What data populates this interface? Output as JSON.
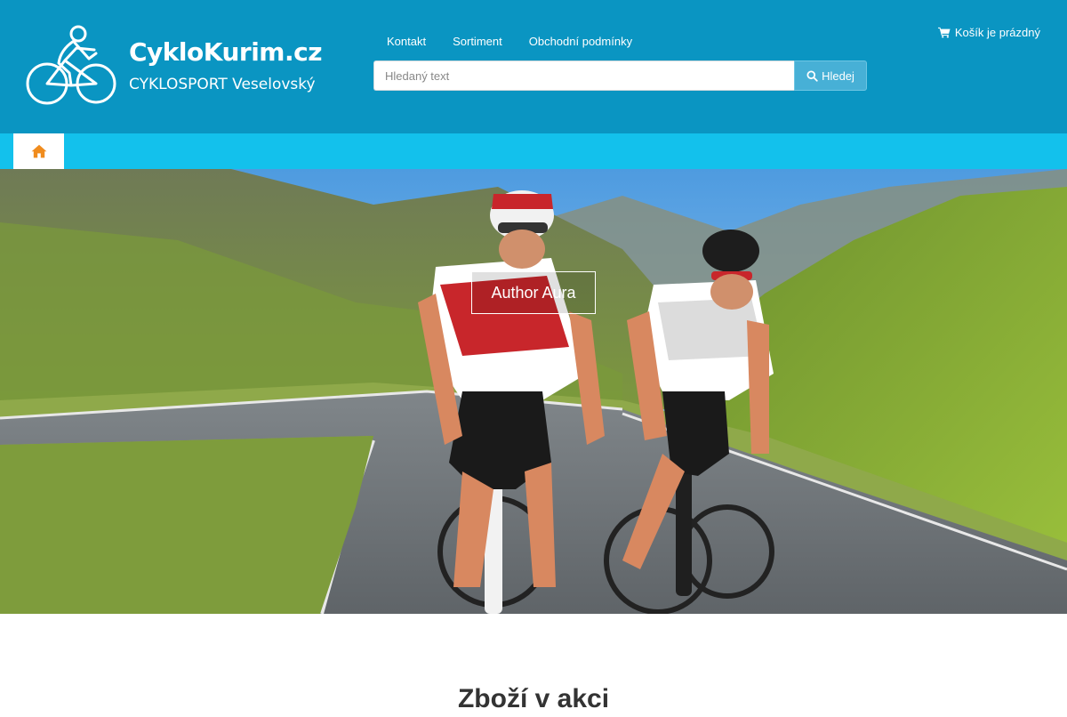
{
  "header": {
    "site_name": "CykloKurim.cz",
    "site_subtitle": "CYKLOSPORT Veselovský",
    "logo_icon": "cyclist-logo-icon",
    "background_color": "#0a95c2"
  },
  "top_nav": {
    "items": [
      {
        "label": "Kontakt"
      },
      {
        "label": "Sortiment"
      },
      {
        "label": "Obchodní podmínky"
      }
    ]
  },
  "search": {
    "placeholder": "Hledaný text",
    "value": "",
    "button_label": "Hledej",
    "button_icon": "search-icon"
  },
  "cart": {
    "label": "Košík je prázdný",
    "icon": "shopping-cart-icon"
  },
  "menubar": {
    "home_icon": "home-icon",
    "background_color": "#13c1ec",
    "home_icon_color": "#f08c1e"
  },
  "hero": {
    "caption": "Author Aura"
  },
  "section": {
    "title": "Zboží v akci"
  }
}
